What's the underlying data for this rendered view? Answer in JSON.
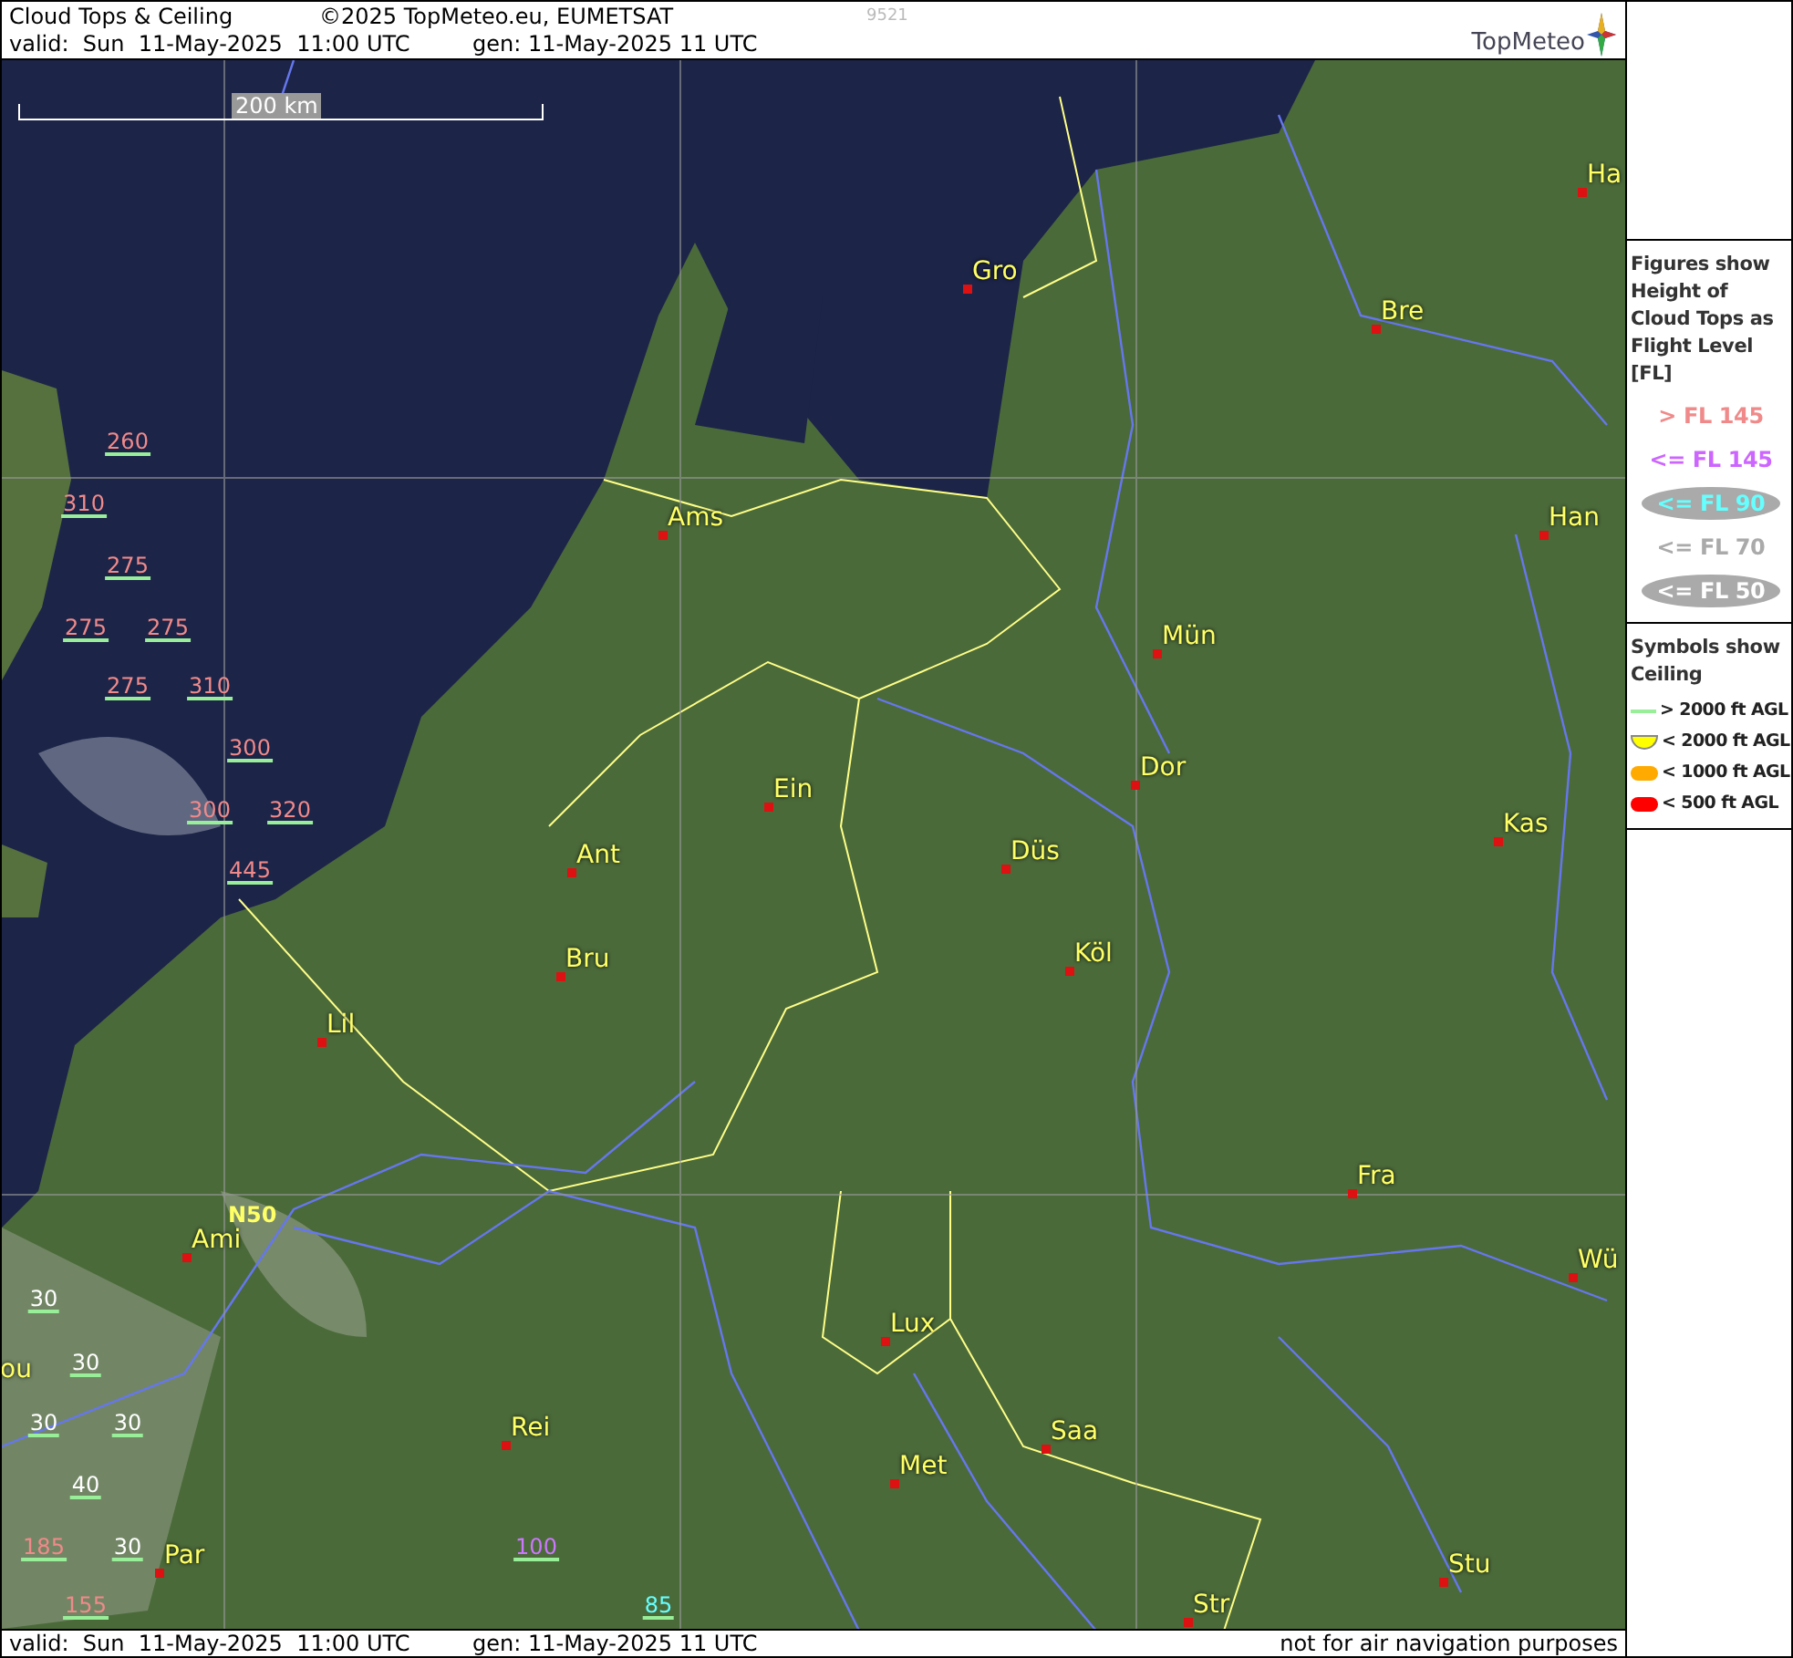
{
  "header": {
    "title": "Cloud Tops & Ceiling",
    "copyright": "©2025 TopMeteo.eu, EUMETSAT",
    "code": "9521",
    "valid": "valid:  Sun  11-May-2025  11:00 UTC",
    "generated": "gen: 11-May-2025 11 UTC",
    "logo": "TopMeteo"
  },
  "map": {
    "scale_label": "200 km",
    "grid_label": "N50",
    "cities": [
      {
        "name": "Ha"
      },
      {
        "name": "Gro"
      },
      {
        "name": "Bre"
      },
      {
        "name": "Ams"
      },
      {
        "name": "Han"
      },
      {
        "name": "Mün"
      },
      {
        "name": "Dor"
      },
      {
        "name": "Ein"
      },
      {
        "name": "Düs"
      },
      {
        "name": "Kas"
      },
      {
        "name": "Ant"
      },
      {
        "name": "Köl"
      },
      {
        "name": "Bru"
      },
      {
        "name": "Lil"
      },
      {
        "name": "Fra"
      },
      {
        "name": "Ami"
      },
      {
        "name": "Wü"
      },
      {
        "name": "Lux"
      },
      {
        "name": "ou"
      },
      {
        "name": "Saa"
      },
      {
        "name": "Rei"
      },
      {
        "name": "Met"
      },
      {
        "name": "Par"
      },
      {
        "name": "Stu"
      },
      {
        "name": "Str"
      }
    ],
    "cloud_tops": [
      {
        "value": "260",
        "color": "#f08a8a"
      },
      {
        "value": "310",
        "color": "#f08a8a"
      },
      {
        "value": "275",
        "color": "#f08a8a"
      },
      {
        "value": "275",
        "color": "#f08a8a"
      },
      {
        "value": "275",
        "color": "#f08a8a"
      },
      {
        "value": "275",
        "color": "#f08a8a"
      },
      {
        "value": "310",
        "color": "#f08a8a"
      },
      {
        "value": "300",
        "color": "#f08a8a"
      },
      {
        "value": "300",
        "color": "#f08a8a"
      },
      {
        "value": "320",
        "color": "#f08a8a"
      },
      {
        "value": "445",
        "color": "#f08a8a"
      },
      {
        "value": "30",
        "color": "#ffffff"
      },
      {
        "value": "30",
        "color": "#ffffff"
      },
      {
        "value": "30",
        "color": "#ffffff"
      },
      {
        "value": "30",
        "color": "#ffffff"
      },
      {
        "value": "40",
        "color": "#ffffff"
      },
      {
        "value": "185",
        "color": "#f08a8a"
      },
      {
        "value": "30",
        "color": "#ffffff"
      },
      {
        "value": "155",
        "color": "#f08a8a"
      },
      {
        "value": "100",
        "color": "#cc77ff"
      },
      {
        "value": "85",
        "color": "#66ffff"
      }
    ]
  },
  "legend": {
    "figures_title": "Figures show Height of Cloud Tops as Flight Level  [FL]",
    "figures": [
      {
        "label": "> FL 145",
        "color": "#f08a8a",
        "oval": false
      },
      {
        "label": "<= FL 145",
        "color": "#cc66ff",
        "oval": false
      },
      {
        "label": "<= FL 90",
        "color": "#66ffff",
        "oval": true
      },
      {
        "label": "<= FL 70",
        "color": "#aaaaaa",
        "oval": false
      },
      {
        "label": "<= FL 50",
        "color": "#ffffff",
        "oval": true
      }
    ],
    "symbols_title": "Symbols show Ceiling",
    "symbols": [
      {
        "kind": "line",
        "color": "#99ee99",
        "label": "> 2000 ft AGL"
      },
      {
        "kind": "cup",
        "color": "#ffff00",
        "label": "< 2000 ft AGL"
      },
      {
        "kind": "pill",
        "color": "#ffaa00",
        "label": "< 1000 ft AGL"
      },
      {
        "kind": "pill",
        "color": "#ff0000",
        "label": "< 500 ft AGL"
      }
    ]
  },
  "footer": {
    "valid": "valid:  Sun  11-May-2025  11:00 UTC",
    "generated": "gen: 11-May-2025 11 UTC",
    "disclaimer": "not for air navigation purposes"
  }
}
